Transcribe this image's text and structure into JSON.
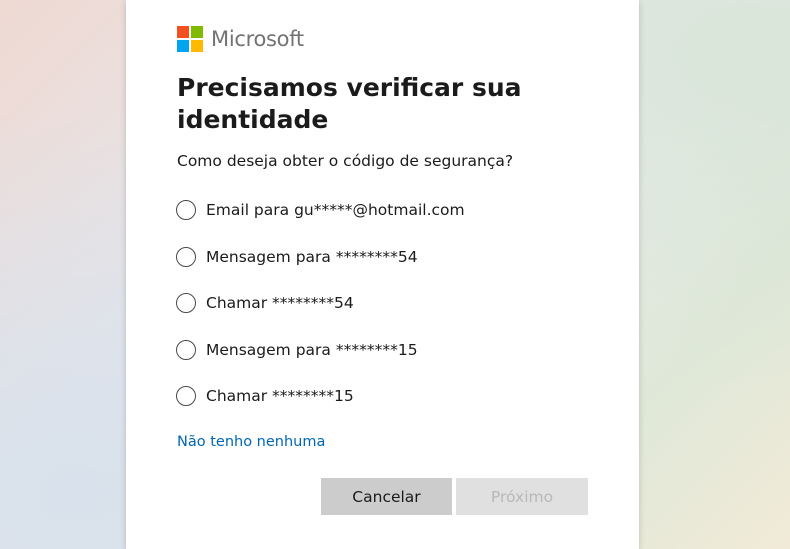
{
  "brand": {
    "name": "Microsoft",
    "logo_colors": [
      "#f25022",
      "#7fba00",
      "#00a4ef",
      "#ffb900"
    ]
  },
  "dialog": {
    "title": "Precisamos verificar sua identidade",
    "subtitle": "Como deseja obter o código de segurança?",
    "options": [
      {
        "label": "Email para gu*****@hotmail.com",
        "selected": false
      },
      {
        "label": "Mensagem para ********54",
        "selected": false
      },
      {
        "label": "Chamar ********54",
        "selected": false
      },
      {
        "label": "Mensagem para ********15",
        "selected": false
      },
      {
        "label": "Chamar ********15",
        "selected": false
      }
    ],
    "none_link": "Não tenho nenhuma",
    "cancel_label": "Cancelar",
    "next_label": "Próximo",
    "next_enabled": false
  },
  "colors": {
    "link": "#0067b8",
    "cancel_button_bg": "#cccccc",
    "next_button_bg_disabled": "#e0e0e0",
    "next_button_text_disabled": "#b8b8b8"
  }
}
